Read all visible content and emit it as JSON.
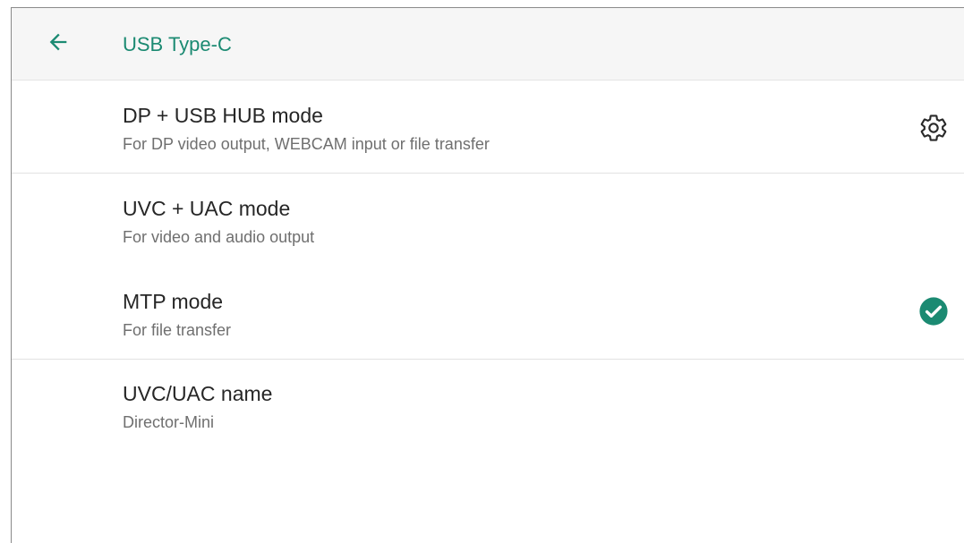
{
  "toolbar": {
    "title": "USB Type-C",
    "back_icon": "arrow-back-icon",
    "accent_color": "#1b8a72"
  },
  "preferences": [
    {
      "title": "DP + USB HUB mode",
      "summary": "For DP video output, WEBCAM input or file transfer",
      "trailing_icon": "gear-icon"
    },
    {
      "title": "UVC + UAC mode",
      "summary": "For video and audio output"
    },
    {
      "title": "MTP mode",
      "summary": "For file transfer",
      "trailing_icon": "check-circle-icon",
      "selected": true
    },
    {
      "title": "UVC/UAC name",
      "summary": "Director-Mini"
    }
  ]
}
